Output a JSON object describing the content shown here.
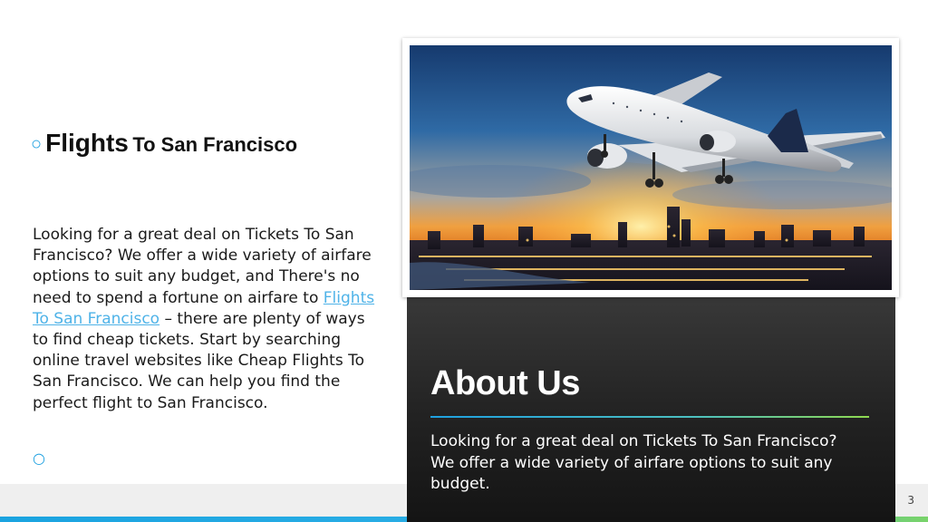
{
  "heading": {
    "bullet": "○",
    "title_big": "Flights",
    "title_rest": "To San Francisco"
  },
  "body": {
    "text_before": " Looking for a great deal on Tickets To San Francisco? We offer a wide variety of airfare options to suit any budget, and There's no need to spend a fortune on airfare to ",
    "link": "Flights To San Francisco",
    "text_after": " – there are plenty of ways to find cheap tickets. Start by searching online travel websites like Cheap Flights To San Francisco. We can help you find the perfect flight to San Francisco."
  },
  "empty_bullet": "○",
  "about": {
    "title": "About Us",
    "text": "Looking for a great deal on Tickets To San Francisco? We offer a wide variety of airfare options to suit any budget."
  },
  "page_number": "3",
  "colors": {
    "accent_blue": "#1ea0e0",
    "link": "#4fb3e8",
    "accent_green": "#8fd84f",
    "panel_dark": "#222222"
  }
}
